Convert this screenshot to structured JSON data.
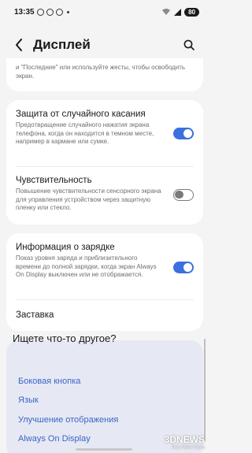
{
  "status_bar": {
    "time": "13:35",
    "battery": "80"
  },
  "header": {
    "title": "Дисплей"
  },
  "top_fragment": {
    "text": "и \"Последние\" или используйте жесты, чтобы освободить экран."
  },
  "card1": {
    "accidental_touch": {
      "title": "Защита от случайного касания",
      "description": "Предотвращение случайного нажатия экрана телефона, когда он находится в темном месте, например в кармане или сумке.",
      "enabled": true
    },
    "sensitivity": {
      "title": "Чувствительность",
      "description": "Повышение чувствительности сенсорного экрана для управления устройством через защитную пленку или стекло.",
      "enabled": false
    }
  },
  "card2": {
    "charging_info": {
      "title": "Информация о зарядке",
      "description": "Показ уровня заряда и приблизительного времени до полной зарядки, когда экран Always On Display выключен или не отображается.",
      "enabled": true
    },
    "screensaver": {
      "title": "Заставка"
    }
  },
  "suggestions": {
    "title": "Ищете что-то другое?",
    "links": [
      "Боковая кнопка",
      "Язык",
      "Улучшение отображения",
      "Always On Display"
    ]
  },
  "watermark": {
    "brand": "3DNEWS",
    "tagline": "Daily Digital Digest"
  },
  "colors": {
    "accent": "#3c6fe0",
    "link": "#3a64c8",
    "background": "#f4f4f4",
    "suggest_bg": "#e6e9f3"
  }
}
